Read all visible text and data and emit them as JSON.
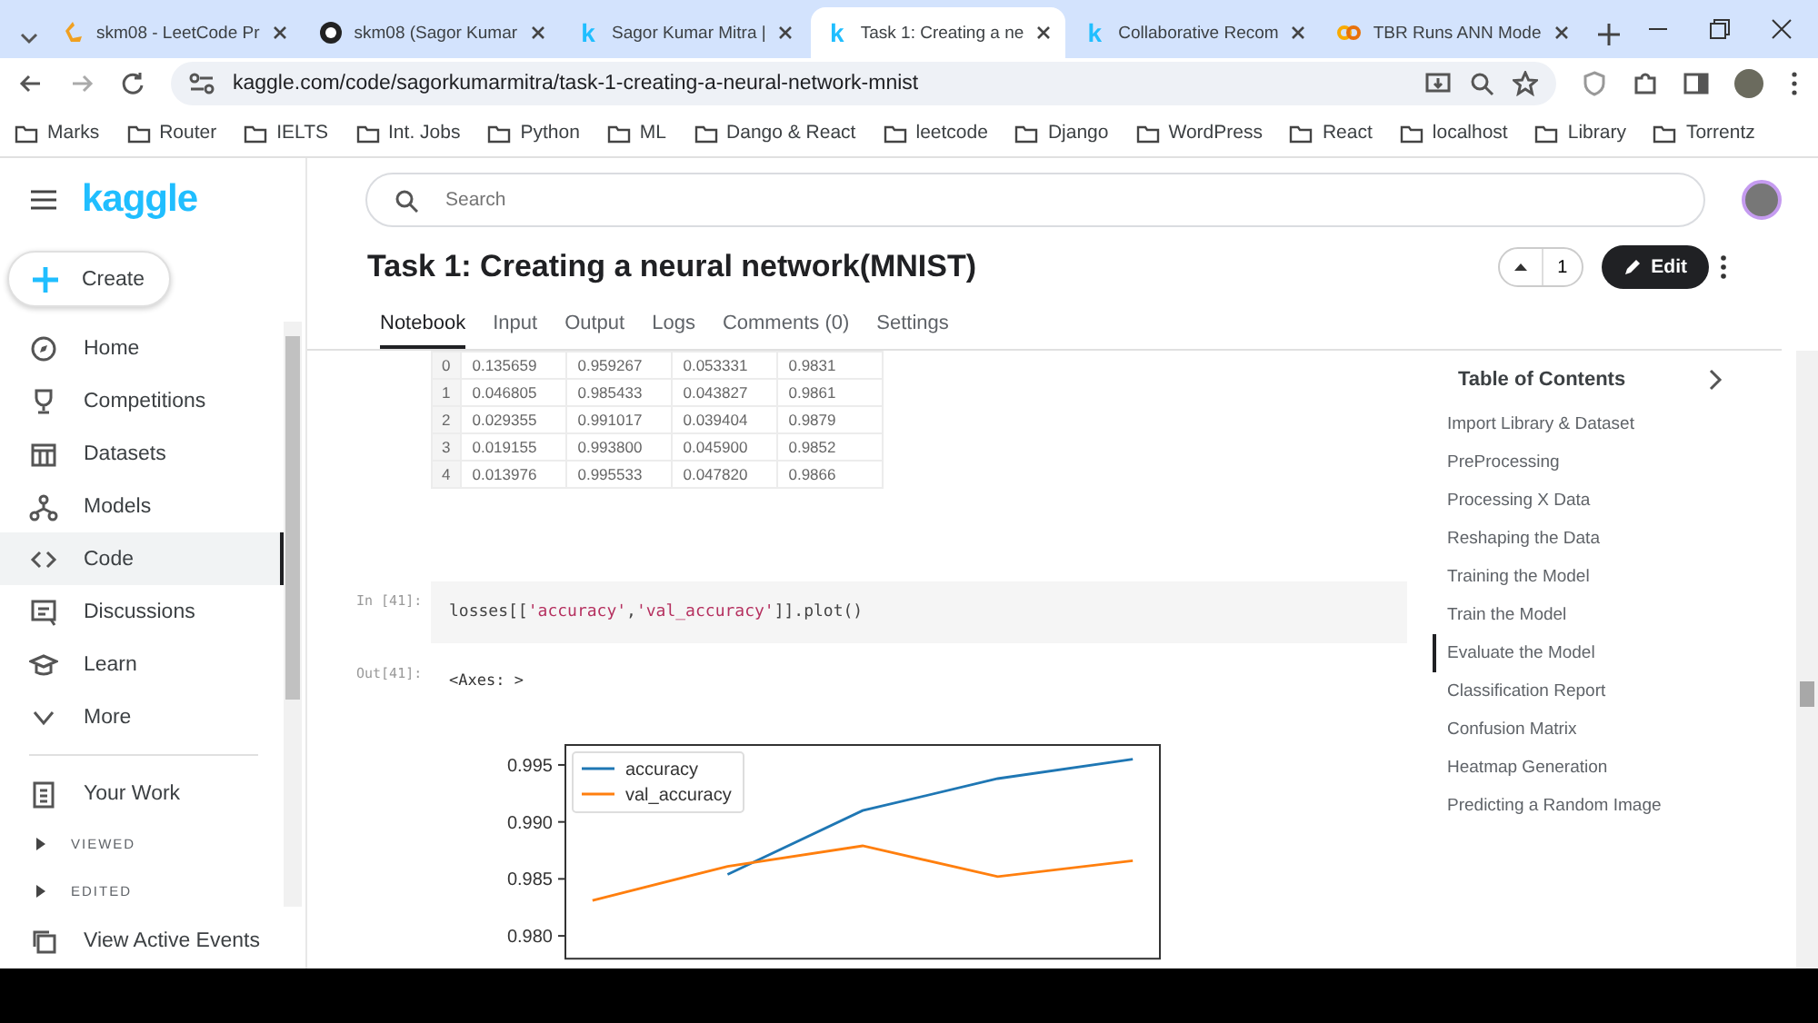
{
  "browser": {
    "tabs": [
      {
        "title": "skm08 - LeetCode Pr",
        "selected": false
      },
      {
        "title": "skm08 (Sagor Kumar",
        "selected": false
      },
      {
        "title": "Sagor Kumar Mitra | ",
        "glyph": "k",
        "selected": false
      },
      {
        "title": "Task 1: Creating a ne",
        "glyph": "k",
        "selected": true
      },
      {
        "title": "Collaborative Recom",
        "glyph": "k",
        "selected": false
      },
      {
        "title": "TBR Runs ANN Mode",
        "selected": false
      }
    ],
    "address": "kaggle.com/code/sagorkumarmitra/task-1-creating-a-neural-network-mnist",
    "bookmarks": [
      "Marks",
      "Router",
      "IELTS",
      "Int. Jobs",
      "Python",
      "ML",
      "Dango & React",
      "leetcode",
      "Django",
      "WordPress",
      "React",
      "localhost",
      "Library",
      "Torrentz"
    ]
  },
  "sidebar": {
    "logo": "kaggle",
    "create": "Create",
    "items": [
      {
        "label": "Home",
        "selected": false
      },
      {
        "label": "Competitions",
        "selected": false
      },
      {
        "label": "Datasets",
        "selected": false
      },
      {
        "label": "Models",
        "selected": false
      },
      {
        "label": "Code",
        "selected": true
      },
      {
        "label": "Discussions",
        "selected": false
      },
      {
        "label": "Learn",
        "selected": false
      },
      {
        "label": "More",
        "selected": false
      }
    ],
    "your_work": "Your Work",
    "sections": [
      "VIEWED",
      "EDITED"
    ],
    "events": "View Active Events"
  },
  "search": {
    "placeholder": "Search"
  },
  "notebook": {
    "title": "Task 1: Creating a neural network(MNIST)",
    "votes": "1",
    "edit": "Edit",
    "tabs": [
      {
        "label": "Notebook",
        "selected": true
      },
      {
        "label": "Input",
        "selected": false
      },
      {
        "label": "Output",
        "selected": false
      },
      {
        "label": "Logs",
        "selected": false
      },
      {
        "label": "Comments (0)",
        "selected": false
      },
      {
        "label": "Settings",
        "selected": false
      }
    ],
    "table": {
      "rows": [
        [
          "0",
          "0.135659",
          "0.959267",
          "0.053331",
          "0.9831"
        ],
        [
          "1",
          "0.046805",
          "0.985433",
          "0.043827",
          "0.9861"
        ],
        [
          "2",
          "0.029355",
          "0.991017",
          "0.039404",
          "0.9879"
        ],
        [
          "3",
          "0.019155",
          "0.993800",
          "0.045900",
          "0.9852"
        ],
        [
          "4",
          "0.013976",
          "0.995533",
          "0.047820",
          "0.9866"
        ]
      ]
    },
    "in_prompt": "In [41]:",
    "code": [
      {
        "text": "losses[[",
        "kind": "plain"
      },
      {
        "text": "'accuracy'",
        "kind": "string"
      },
      {
        "text": ",",
        "kind": "plain"
      },
      {
        "text": "'val_accuracy'",
        "kind": "string"
      },
      {
        "text": "]].plot()",
        "kind": "plain"
      }
    ],
    "out_prompt": "Out[41]:",
    "output": "<Axes: >",
    "chart_data": {
      "type": "line",
      "categories": [
        null,
        null,
        null,
        null,
        null
      ],
      "legend": "upper left",
      "ylim": [
        0.978,
        0.99675
      ],
      "yticks": [
        {
          "value": 0.98,
          "label": "0.980"
        },
        {
          "value": 0.985,
          "label": "0.985"
        },
        {
          "value": 0.99,
          "label": "0.990"
        },
        {
          "value": 0.995,
          "label": "0.995"
        }
      ],
      "series": [
        {
          "name": "accuracy",
          "color": "#1f77b4",
          "values": [
            null,
            0.9854,
            0.991,
            0.9938,
            0.9955
          ]
        },
        {
          "name": "val_accuracy",
          "color": "#ff7f0e",
          "values": [
            0.9831,
            0.9861,
            0.9879,
            0.9852,
            0.9866
          ]
        }
      ]
    }
  },
  "toc": {
    "title": "Table of Contents",
    "items": [
      {
        "label": "Import Library & Dataset",
        "selected": false
      },
      {
        "label": "PreProcessing",
        "selected": false
      },
      {
        "label": "Processing X Data",
        "selected": false
      },
      {
        "label": "Reshaping the Data",
        "selected": false
      },
      {
        "label": "Training the Model",
        "selected": false
      },
      {
        "label": "Train the Model",
        "selected": false
      },
      {
        "label": "Evaluate the Model",
        "selected": true
      },
      {
        "label": "Classification Report",
        "selected": false
      },
      {
        "label": "Confusion Matrix",
        "selected": false
      },
      {
        "label": "Heatmap Generation",
        "selected": false
      },
      {
        "label": "Predicting a Random Image",
        "selected": false
      }
    ]
  }
}
